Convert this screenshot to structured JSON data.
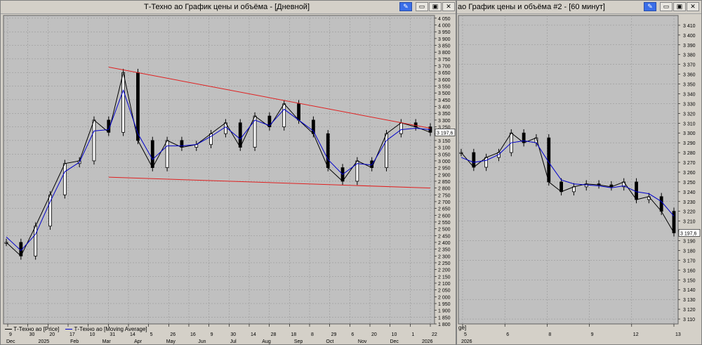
{
  "window1": {
    "title": "Т-Техно ао График цены и объёма - [Дневной]",
    "buttons": [
      "pin-icon",
      "minimize-icon",
      "restore-icon",
      "close-icon"
    ],
    "legend": [
      {
        "label": "Т-Техно ао [Price]",
        "color": "#000000"
      },
      {
        "label": "Т-Техно ао [Moving Average]",
        "color": "#0000cc"
      }
    ],
    "last_price_label": "3 197,6"
  },
  "window2": {
    "title": "ао График цены и объёма #2 - [60 минут]",
    "buttons": [
      "pin-icon",
      "minimize-icon",
      "restore-icon",
      "close-icon"
    ],
    "last_price_label": "3 197,6",
    "legend_stub": "ge]"
  },
  "colors": {
    "background": "#c0c0c0",
    "price": "#000000",
    "ma": "#0000cc",
    "trendline": "#e02020",
    "grid": "#909090"
  },
  "chart_data": [
    {
      "type": "line",
      "title": "Т-Техно ао График цены и объёма - [Дневной]",
      "price_style": "candlestick",
      "ylim": [
        1800,
        4070
      ],
      "y_ticks": [
        "4 050",
        "4 000",
        "3 950",
        "3 900",
        "3 850",
        "3 800",
        "3 750",
        "3 700",
        "3 650",
        "3 600",
        "3 550",
        "3 500",
        "3 450",
        "3 400",
        "3 350",
        "3 300",
        "3 250",
        "3 200",
        "3 150",
        "3 100",
        "3 050",
        "3 000",
        "2 950",
        "2 900",
        "2 850",
        "2 800",
        "2 750",
        "2 700",
        "2 650",
        "2 600",
        "2 550",
        "2 500",
        "2 450",
        "2 400",
        "2 350",
        "2 300",
        "2 250",
        "2 200",
        "2 150",
        "2 100",
        "2 050",
        "2 000",
        "1 950",
        "1 900",
        "1 850",
        "1 800"
      ],
      "x_day_ticks": [
        "9",
        "30",
        "20",
        "17",
        "10",
        "31",
        "14",
        "5",
        "26",
        "16",
        "9",
        "30",
        "14",
        "28",
        "18",
        "8",
        "29",
        "6",
        "20",
        "10",
        "1",
        "22"
      ],
      "x_month_ticks": [
        "Dec",
        "2025",
        "Feb",
        "Mar",
        "Apr",
        "May",
        "Jun",
        "Jul",
        "Aug",
        "Sep",
        "Oct",
        "Nov",
        "Dec",
        "2026"
      ],
      "x": [
        "2024-12-09",
        "2024-12-20",
        "2025-01-03",
        "2025-01-20",
        "2025-02-05",
        "2025-02-20",
        "2025-03-05",
        "2025-03-14",
        "2025-03-28",
        "2025-04-08",
        "2025-04-22",
        "2025-05-05",
        "2025-05-20",
        "2025-06-05",
        "2025-06-20",
        "2025-07-03",
        "2025-07-18",
        "2025-08-01",
        "2025-08-15",
        "2025-08-29",
        "2025-09-12",
        "2025-09-26",
        "2025-10-10",
        "2025-10-24",
        "2025-11-07",
        "2025-11-21",
        "2025-12-05",
        "2025-12-19",
        "2026-01-02",
        "2026-01-09"
      ],
      "series": [
        {
          "name": "Т-Техно ао [Price]",
          "values": [
            2400,
            2300,
            2520,
            2750,
            2980,
            3000,
            3300,
            3210,
            3650,
            3150,
            2950,
            3150,
            3100,
            3120,
            3200,
            3280,
            3100,
            3330,
            3250,
            3420,
            3300,
            3200,
            2950,
            2850,
            3000,
            2950,
            3200,
            3280,
            3250,
            3210
          ]
        },
        {
          "name": "Т-Техно ао [Moving Average]",
          "values": [
            2440,
            2340,
            2460,
            2700,
            2920,
            2990,
            3220,
            3230,
            3520,
            3200,
            3010,
            3110,
            3110,
            3120,
            3180,
            3250,
            3160,
            3300,
            3260,
            3380,
            3300,
            3220,
            3010,
            2900,
            2980,
            2970,
            3150,
            3230,
            3240,
            3230
          ]
        }
      ],
      "trendlines": [
        {
          "from": [
            "2025-03-10",
            3690
          ],
          "to": [
            "2026-01-10",
            3240
          ]
        },
        {
          "from": [
            "2025-03-14",
            2880
          ],
          "to": [
            "2026-01-10",
            2800
          ]
        }
      ]
    },
    {
      "type": "line",
      "title": "ао График цены и объёма #2 - [60 минут]",
      "price_style": "candlestick",
      "ylim": [
        3105,
        3420
      ],
      "y_ticks": [
        "3 410",
        "3 400",
        "3 390",
        "3 380",
        "3 370",
        "3 360",
        "3 350",
        "3 340",
        "3 330",
        "3 320",
        "3 310",
        "3 300",
        "3 290",
        "3 280",
        "3 270",
        "3 260",
        "3 250",
        "3 240",
        "3 230",
        "3 220",
        "3 210",
        "3 200",
        "3 190",
        "3 180",
        "3 170",
        "3 160",
        "3 150",
        "3 140",
        "3 130",
        "3 120",
        "3 110"
      ],
      "x_day_ticks": [
        "5",
        "6",
        "8",
        "9",
        "12",
        "13"
      ],
      "x_month_ticks": [
        "2026"
      ],
      "x": [
        "Jan5-09",
        "Jan5-13",
        "Jan5-17",
        "Jan6-10",
        "Jan6-14",
        "Jan6-18",
        "Jan8-10",
        "Jan8-14",
        "Jan8-18",
        "Jan9-10",
        "Jan9-14",
        "Jan9-18",
        "Jan12-10",
        "Jan12-14",
        "Jan12-18",
        "Jan13-10",
        "Jan13-14",
        "Jan13-18"
      ],
      "series": [
        {
          "name": "Price",
          "values": [
            3280,
            3265,
            3275,
            3280,
            3300,
            3290,
            3295,
            3250,
            3240,
            3245,
            3248,
            3247,
            3245,
            3250,
            3232,
            3235,
            3220,
            3198
          ]
        },
        {
          "name": "Moving Average",
          "values": [
            3275,
            3270,
            3272,
            3278,
            3290,
            3292,
            3290,
            3270,
            3252,
            3248,
            3247,
            3246,
            3244,
            3246,
            3240,
            3238,
            3230,
            3215
          ]
        }
      ]
    }
  ]
}
